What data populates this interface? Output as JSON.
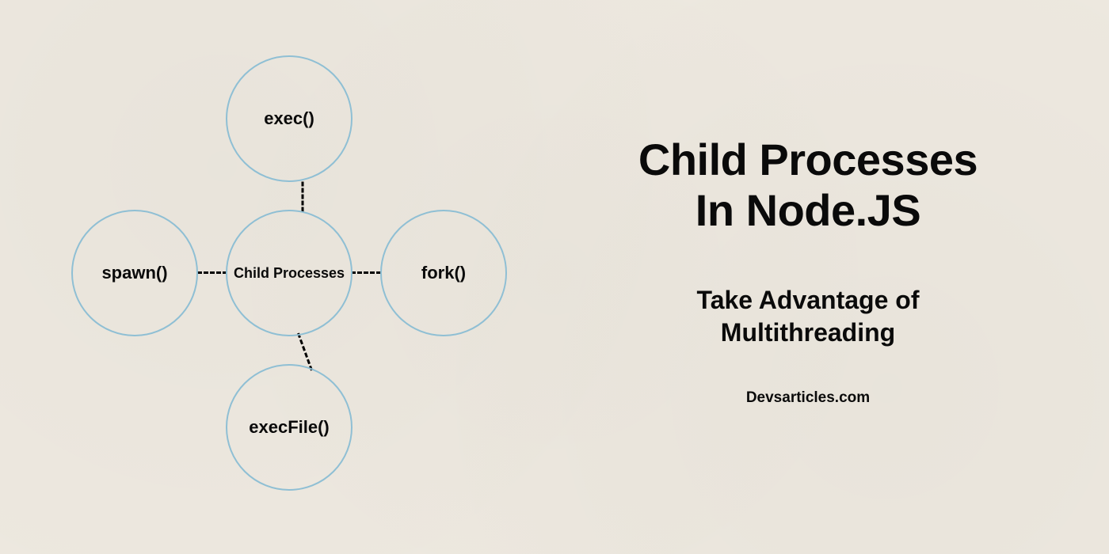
{
  "diagram": {
    "center_label": "Child Processes",
    "nodes": {
      "top": "exec()",
      "right": "fork()",
      "bottom": "execFile()",
      "left": "spawn()"
    }
  },
  "text": {
    "title_line1": "Child Processes",
    "title_line2": "In Node.JS",
    "subtitle_line1": "Take Advantage of",
    "subtitle_line2": "Multithreading",
    "site": "Devsarticles.com"
  },
  "colors": {
    "circle_border": "#8fbfd4",
    "text": "#0a0a0a",
    "background": "#ede8df"
  }
}
